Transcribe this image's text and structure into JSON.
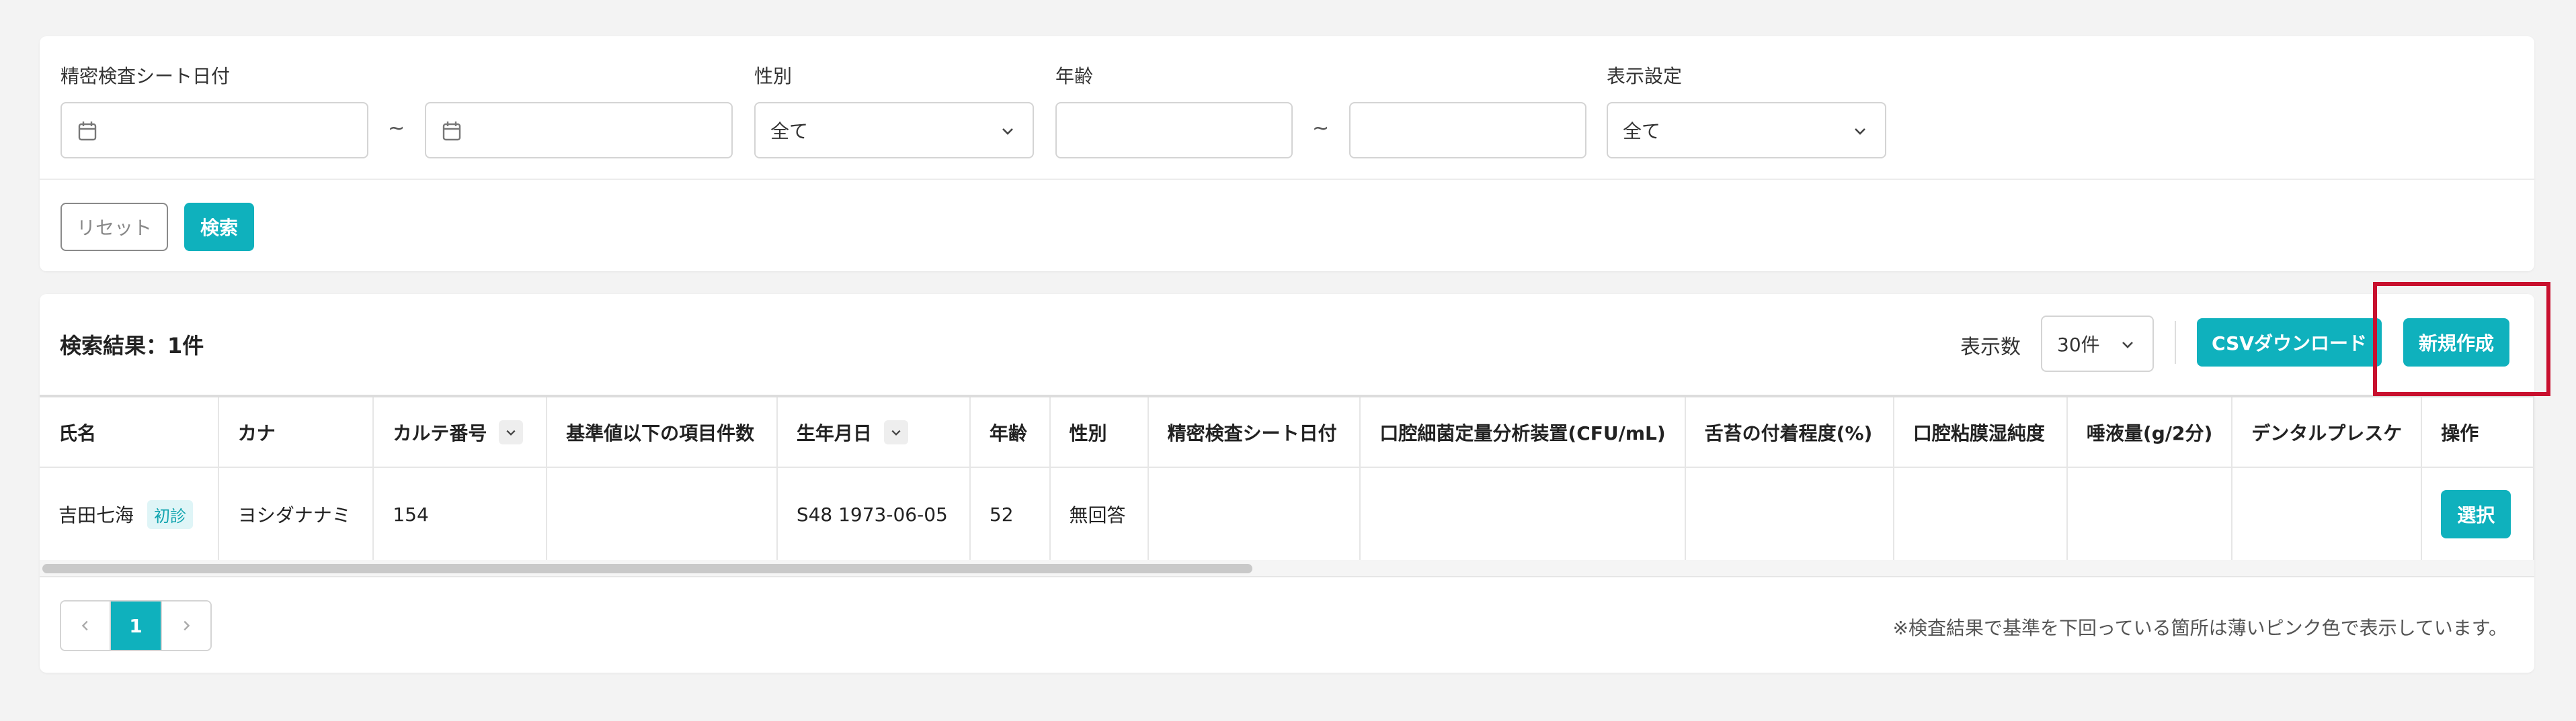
{
  "filter": {
    "date_label": "精密検査シート日付",
    "gender_label": "性別",
    "gender_value": "全て",
    "age_label": "年齢",
    "display_label": "表示設定",
    "display_value": "全て",
    "range_sep": "~",
    "reset_label": "リセット",
    "search_label": "検索"
  },
  "results": {
    "title": "検索結果：1件",
    "count_label": "表示数",
    "count_value": "30件",
    "csv_label": "CSVダウンロード",
    "new_label": "新規作成",
    "columns": [
      "氏名",
      "カナ",
      "カルテ番号",
      "基準値以下の項目件数",
      "生年月日",
      "年齢",
      "性別",
      "精密検査シート日付",
      "口腔細菌定量分析装置(CFU/mL)",
      "舌苔の付着程度(%)",
      "口腔粘膜湿純度",
      "唾液量(g/2分)",
      "デンタルプレスケ",
      "操作"
    ],
    "rows": [
      {
        "name": "吉田七海",
        "badge": "初診",
        "kana": "ヨシダナナミ",
        "chart_no": "154",
        "below_count": "",
        "birth": "S48 1973-06-05",
        "age": "52",
        "gender": "無回答",
        "sheet_date": "",
        "bacteria": "",
        "tongue": "",
        "mucosa": "",
        "saliva": "",
        "dental": "",
        "action_label": "選択"
      }
    ],
    "page": "1",
    "note": "※検査結果で基準を下回っている箇所は薄いピンク色で表示しています。"
  },
  "colors": {
    "accent": "#0fb1bd",
    "highlight": "#c8102e",
    "badge_bg": "#dff5f7"
  }
}
